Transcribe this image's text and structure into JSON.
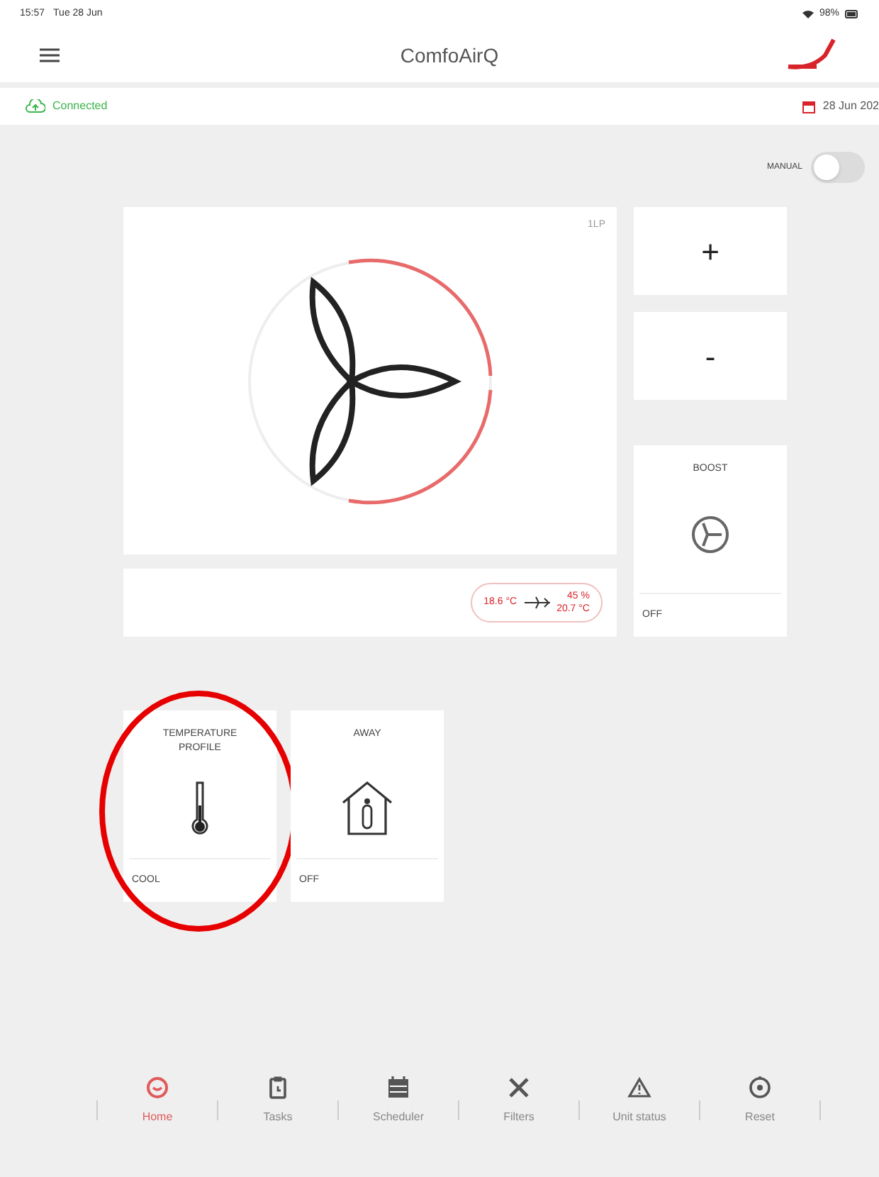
{
  "status_bar": {
    "time": "15:57",
    "date": "Tue 28 Jun",
    "battery": "98%"
  },
  "header": {
    "title": "ComfoAirQ"
  },
  "connection": {
    "label": "Connected",
    "date": "28 Jun 202"
  },
  "manual": {
    "label": "MANUAL",
    "on": false
  },
  "fan": {
    "corner": "1LP",
    "supply_temp": "18.6 °C",
    "humidity": "45 %",
    "extract_temp": "20.7 °C"
  },
  "controls": [
    {
      "label": "+"
    },
    {
      "label": "-"
    }
  ],
  "boost": {
    "title": "BOOST",
    "value": "OFF"
  },
  "tiles": [
    {
      "kind": "thermometer",
      "title": "TEMPERATURE PROFILE",
      "value": "COOL",
      "highlighted": true
    },
    {
      "kind": "house",
      "title": "AWAY",
      "value": "OFF",
      "highlighted": false
    }
  ],
  "nav": [
    {
      "kind": "home",
      "label": "Home",
      "selected": true
    },
    {
      "kind": "tasks",
      "label": "Tasks",
      "selected": false
    },
    {
      "kind": "scheduler",
      "label": "Scheduler",
      "selected": false
    },
    {
      "kind": "filters",
      "label": "Filters",
      "selected": false
    },
    {
      "kind": "status",
      "label": "Unit status",
      "selected": false
    },
    {
      "kind": "reset",
      "label": "Reset",
      "selected": false
    }
  ]
}
